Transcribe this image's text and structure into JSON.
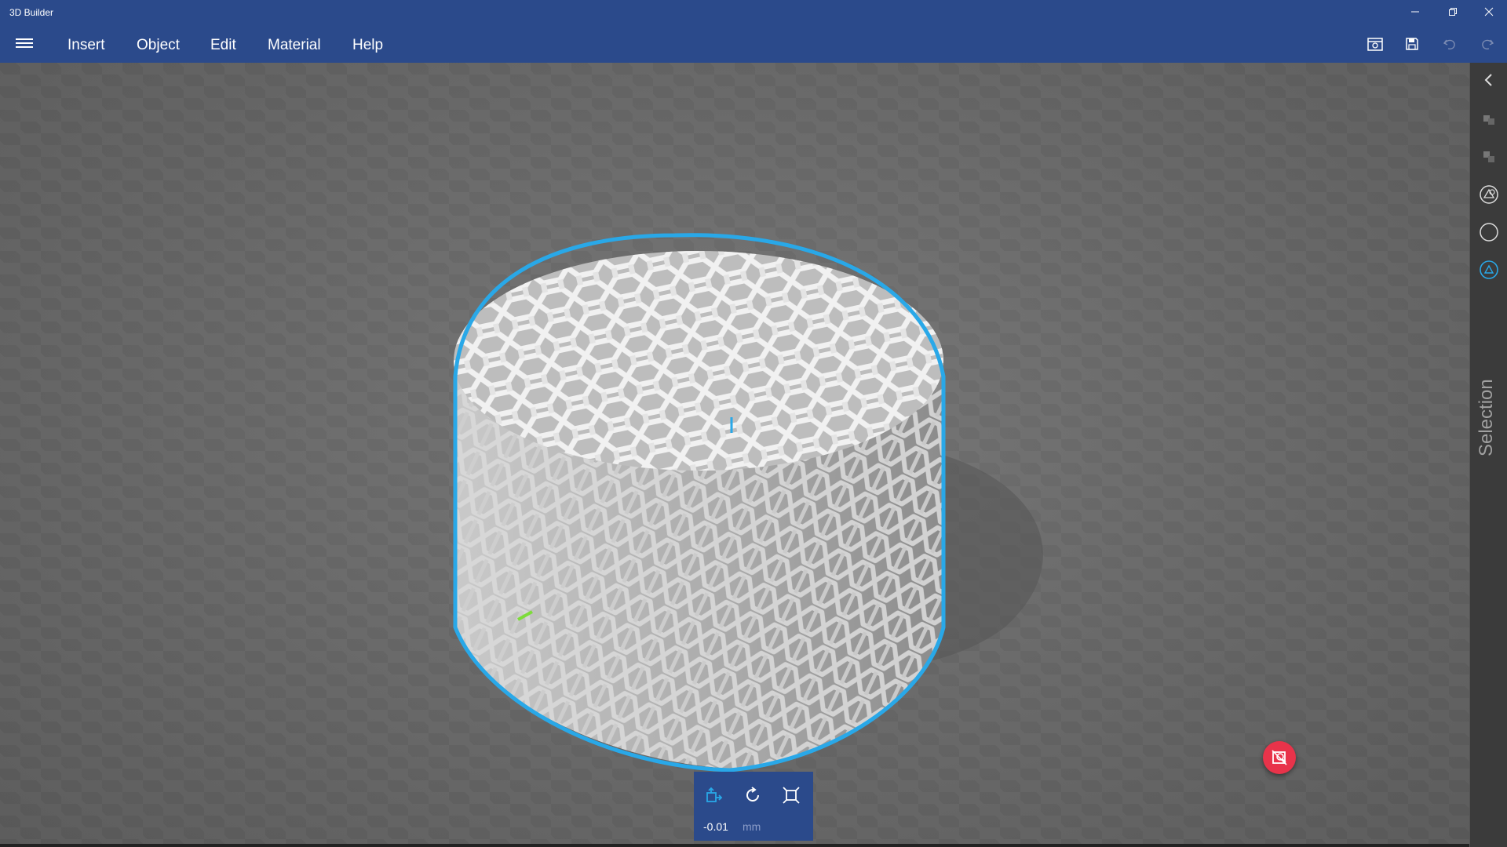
{
  "window": {
    "title": "3D Builder",
    "controls": [
      "minimize",
      "restore",
      "close"
    ]
  },
  "menu": {
    "items": [
      "Insert",
      "Object",
      "Edit",
      "Material",
      "Help"
    ]
  },
  "toolbar": {
    "icons": [
      "3d-print-icon",
      "save-icon",
      "undo-icon",
      "redo-icon"
    ]
  },
  "side_panel": {
    "label": "Selection",
    "icons": [
      "collapse-chevron-icon",
      "select-objects-icon",
      "select-group-icon",
      "select-faces-icon",
      "select-circle-icon",
      "select-triangle-icon"
    ]
  },
  "transform": {
    "value": "-0.01",
    "unit": "mm",
    "modes": [
      "move-icon",
      "rotate-icon",
      "scale-icon"
    ]
  },
  "colors": {
    "titlebar": "#2b4a8b",
    "selection_outline": "#29a8e8",
    "accent_active": "#29a8e8",
    "fab": "#e8334a"
  }
}
